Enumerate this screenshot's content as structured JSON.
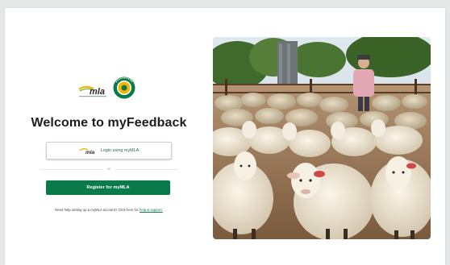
{
  "brand": {
    "logo_text": "mla",
    "seal_text": "FEEDBACK",
    "accent": "#0b7a4a"
  },
  "login": {
    "title": "Welcome to myFeedback",
    "mla_button_label": "Login using myMLA",
    "divider_text": "or",
    "register_label": "Register for myMLA",
    "help_text": "Need help setting up a myMLA account? Click here for ",
    "help_link": "help & support."
  },
  "hero": {
    "icon": "sheep-photo"
  }
}
